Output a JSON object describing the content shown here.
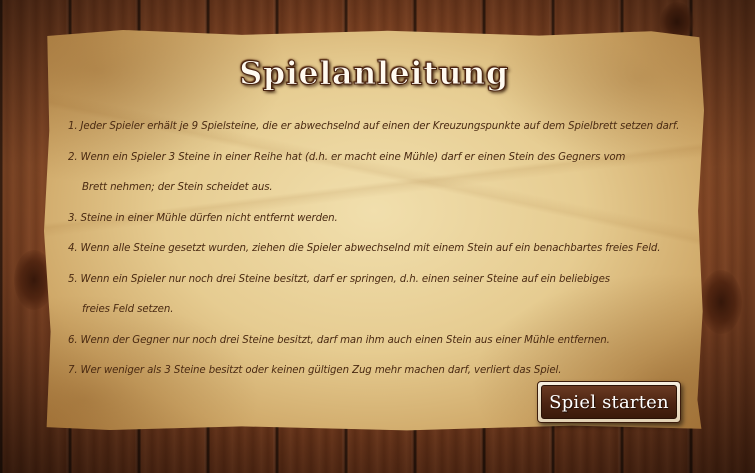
{
  "title": "Spielanleitung",
  "rules": [
    {
      "num": "1.",
      "text": "Jeder Spieler erhält je 9 Spielsteine, die er abwechselnd auf einen der Kreuzungspunkte auf dem Spielbrett setzen darf.",
      "cont": ""
    },
    {
      "num": "2.",
      "text": "Wenn ein Spieler 3 Steine in einer Reihe hat (d.h. er macht eine Mühle) darf er einen Stein des Gegners vom",
      "cont": "Brett nehmen; der Stein scheidet aus."
    },
    {
      "num": "3.",
      "text": "Steine in einer Mühle dürfen nicht entfernt werden.",
      "cont": ""
    },
    {
      "num": "4.",
      "text": "Wenn alle Steine gesetzt wurden, ziehen die Spieler abwechselnd mit einem Stein auf ein benachbartes freies Feld.",
      "cont": ""
    },
    {
      "num": "5.",
      "text": "Wenn ein Spieler nur noch drei Steine besitzt, darf er springen, d.h. einen seiner Steine auf ein beliebiges",
      "cont": "freies Feld setzen."
    },
    {
      "num": "6.",
      "text": "Wenn der Gegner nur noch drei Steine besitzt, darf man ihm auch einen Stein aus einer Mühle entfernen.",
      "cont": ""
    },
    {
      "num": "7.",
      "text": "Wer weniger als 3 Steine besitzt oder keinen gültigen Zug mehr machen darf, verliert das Spiel.",
      "cont": ""
    }
  ],
  "start_button": {
    "label": "Spiel starten"
  },
  "colors": {
    "text": "#4a2a12",
    "button_bg": "#4c2412",
    "button_frame": "#f7efe0",
    "wood": "#7a3e1f",
    "paper": "#e6cc91"
  }
}
